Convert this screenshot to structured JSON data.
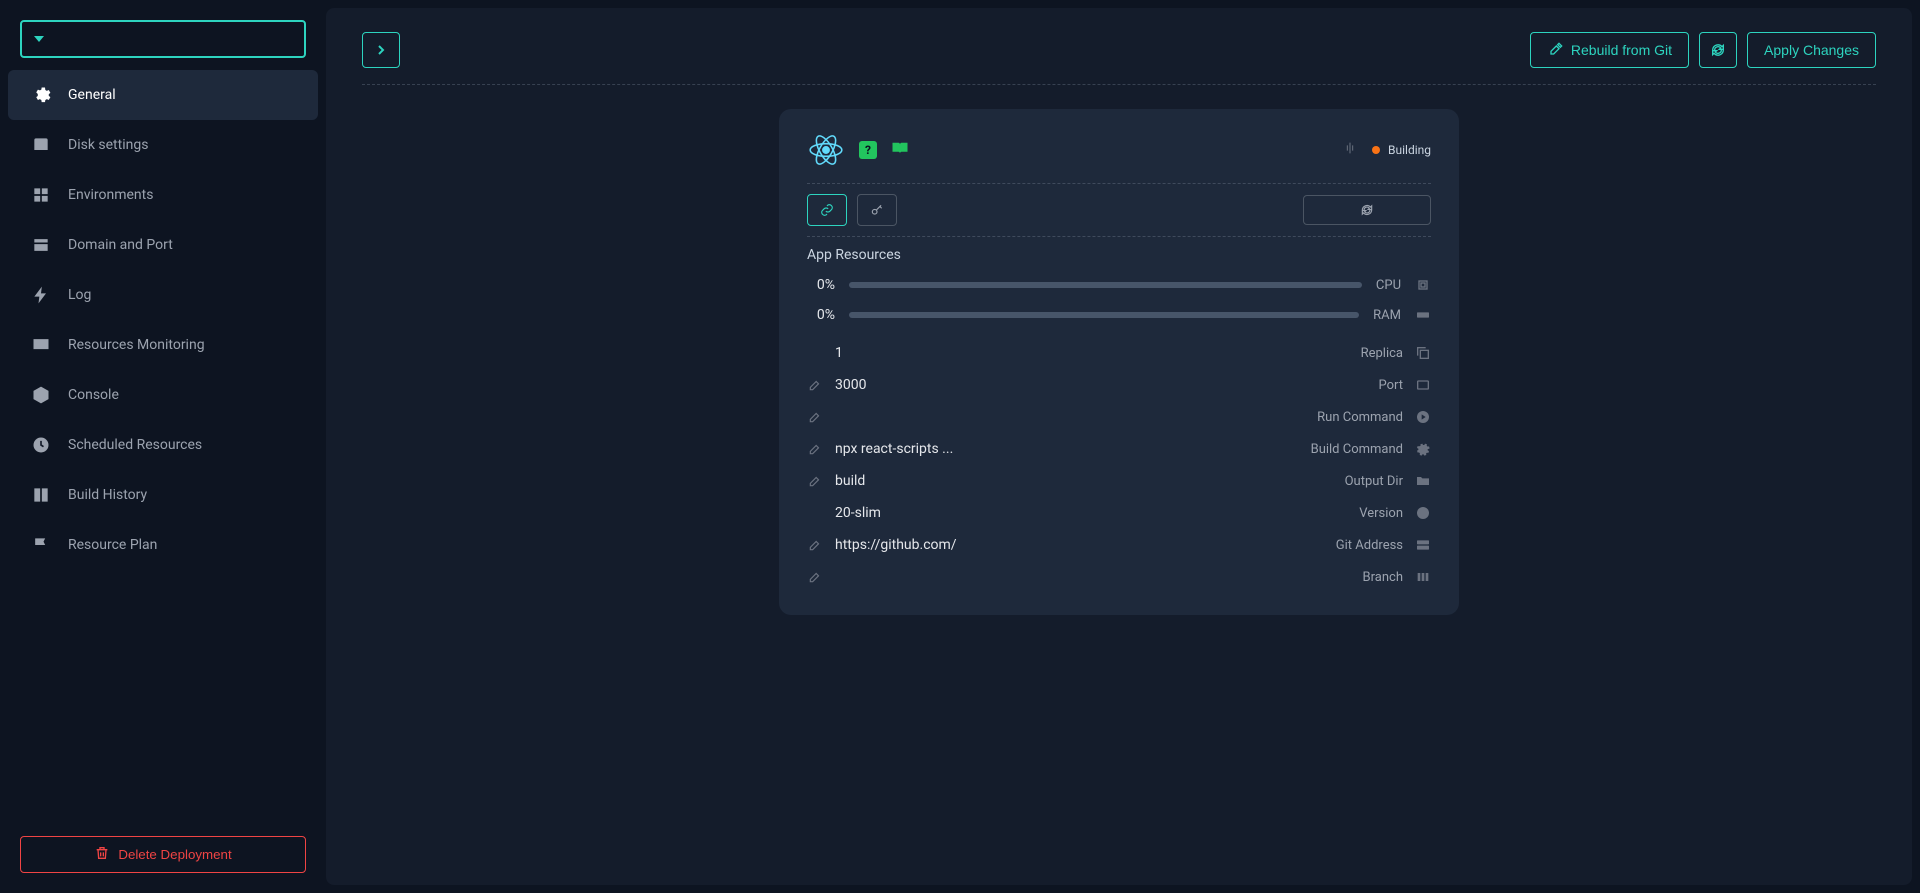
{
  "topbar": {
    "rebuild_label": "Rebuild from Git",
    "apply_label": "Apply Changes"
  },
  "sidebar": {
    "items": [
      {
        "label": "General"
      },
      {
        "label": "Disk settings"
      },
      {
        "label": "Environments"
      },
      {
        "label": "Domain and Port"
      },
      {
        "label": "Log"
      },
      {
        "label": "Resources Monitoring"
      },
      {
        "label": "Console"
      },
      {
        "label": "Scheduled Resources"
      },
      {
        "label": "Build History"
      },
      {
        "label": "Resource Plan"
      }
    ],
    "delete_label": "Delete Deployment"
  },
  "card": {
    "status": "Building",
    "section": "App Resources",
    "cpu": {
      "value": "0%",
      "label": "CPU"
    },
    "ram": {
      "value": "0%",
      "label": "RAM"
    },
    "replica": {
      "value": "1",
      "label": "Replica"
    },
    "port": {
      "value": "3000",
      "label": "Port"
    },
    "run_cmd": {
      "value": "",
      "label": "Run Command"
    },
    "build_cmd": {
      "value": "npx react-scripts ...",
      "label": "Build Command"
    },
    "output_dir": {
      "value": "build",
      "label": "Output Dir"
    },
    "version": {
      "value": "20-slim",
      "label": "Version"
    },
    "git": {
      "value": "https://github.com/",
      "label": "Git Address"
    },
    "branch": {
      "value": "",
      "label": "Branch"
    }
  }
}
